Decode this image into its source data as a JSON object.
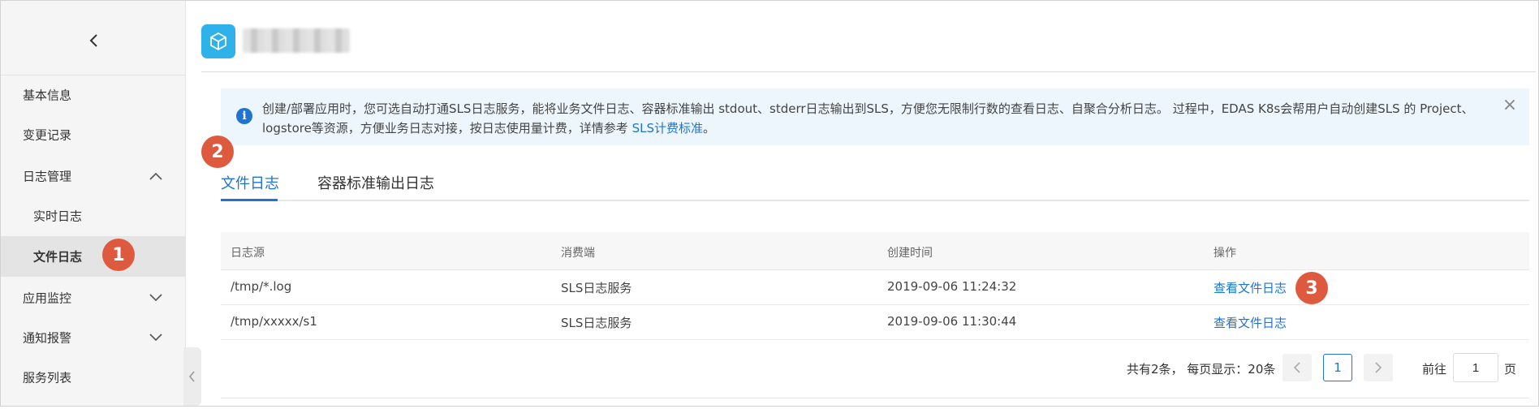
{
  "sidebar": {
    "back_icon": "chevron-left-icon",
    "items": [
      {
        "label": "基本信息"
      },
      {
        "label": "变更记录"
      },
      {
        "label": "日志管理",
        "icon": "chevron-up-icon"
      },
      {
        "label": "实时日志"
      },
      {
        "label": "文件日志"
      },
      {
        "label": "应用监控",
        "icon": "chevron-down-icon"
      },
      {
        "label": "通知报警",
        "icon": "chevron-down-icon"
      },
      {
        "label": "服务列表"
      }
    ]
  },
  "badges": [
    "1",
    "2",
    "3"
  ],
  "banner": {
    "text": "创建/部署应用时，您可选自动打通SLS日志服务，能将业务文件日志、容器标准输出 stdout、stderr日志输出到SLS，方便您无限制行数的查看日志、自聚合分析日志。 过程中，EDAS K8s会帮用户自动创建SLS 的 Project、logstore等资源，方便业务日志对接，按日志使用量计费，详情参考 ",
    "link": "SLS计费标准",
    "end": "。",
    "close": "×"
  },
  "tabs": [
    {
      "label": "文件日志"
    },
    {
      "label": "容器标准输出日志"
    }
  ],
  "table": {
    "headers": [
      "日志源",
      "消费端",
      "创建时间",
      "操作"
    ],
    "rows": [
      {
        "source": "/tmp/*.log",
        "consumer": "SLS日志服务",
        "time": "2019-09-06 11:24:32",
        "action": "查看文件日志"
      },
      {
        "source": "/tmp/xxxxx/s1",
        "consumer": "SLS日志服务",
        "time": "2019-09-06 11:30:44",
        "action": "查看文件日志"
      }
    ]
  },
  "pagination": {
    "total": "共有2条， 每页显示：20条",
    "current": "1",
    "goto_prefix": "前往",
    "goto_value": "1",
    "goto_suffix": "页"
  },
  "colors": {
    "accent": "#1f74d3",
    "badge": "#dd5a3e",
    "banner_bg": "#edf6fd",
    "app_icon": "#2fb1e9"
  }
}
